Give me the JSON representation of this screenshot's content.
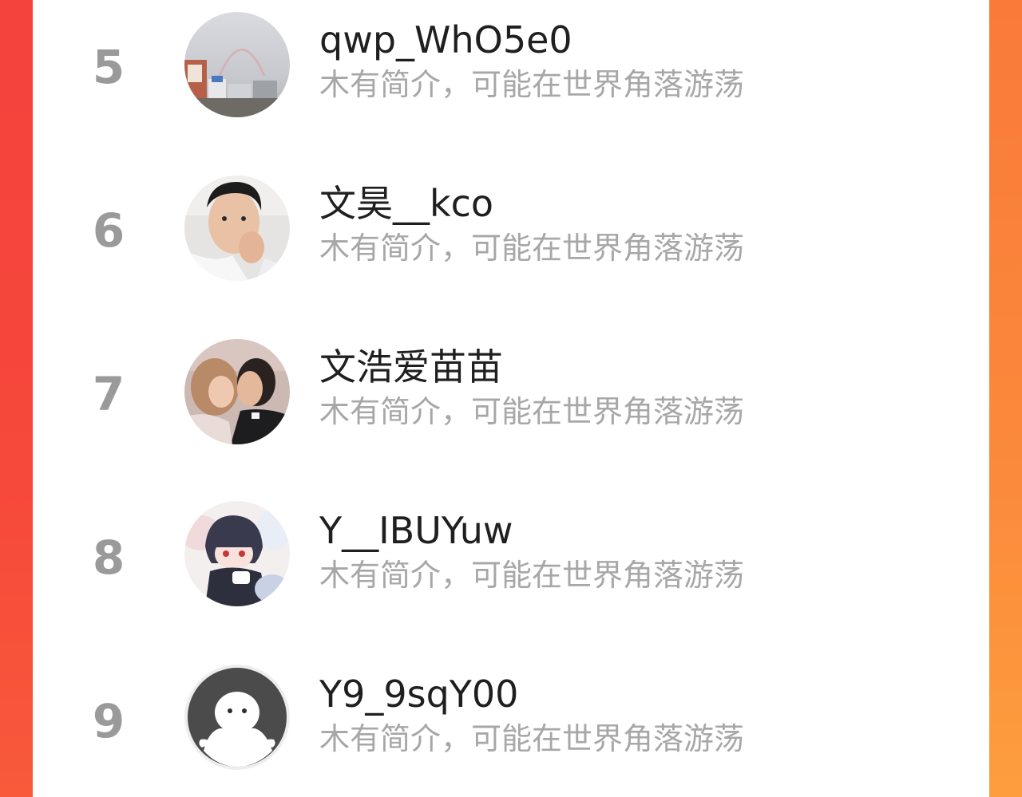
{
  "ranking_list": {
    "items": [
      {
        "rank": "5",
        "name": "qwp_WhO5e0",
        "bio": "木有简介，可能在世界角落游荡",
        "avatar_icon": "sky-street-photo-avatar"
      },
      {
        "rank": "6",
        "name": "文昊__kco",
        "bio": "木有简介，可能在世界角落游荡",
        "avatar_icon": "man-selfie-photo-avatar"
      },
      {
        "rank": "7",
        "name": "文浩爱苗苗",
        "bio": "木有简介，可能在世界角落游荡",
        "avatar_icon": "couple-photo-avatar"
      },
      {
        "rank": "8",
        "name": "Y__IBUYuw",
        "bio": "木有简介，可能在世界角落游荡",
        "avatar_icon": "anime-character-avatar"
      },
      {
        "rank": "9",
        "name": "Y9_9sqY00",
        "bio": "木有简介，可能在世界角落游荡",
        "avatar_icon": "default-user-avatar"
      }
    ]
  },
  "colors": {
    "background_left": "#f4423d",
    "background_right": "#fb8a3c",
    "panel": "#ffffff",
    "rank_text": "#9a9a9a",
    "name_text": "#1f1f1f",
    "bio_text": "#a7a7a7"
  }
}
